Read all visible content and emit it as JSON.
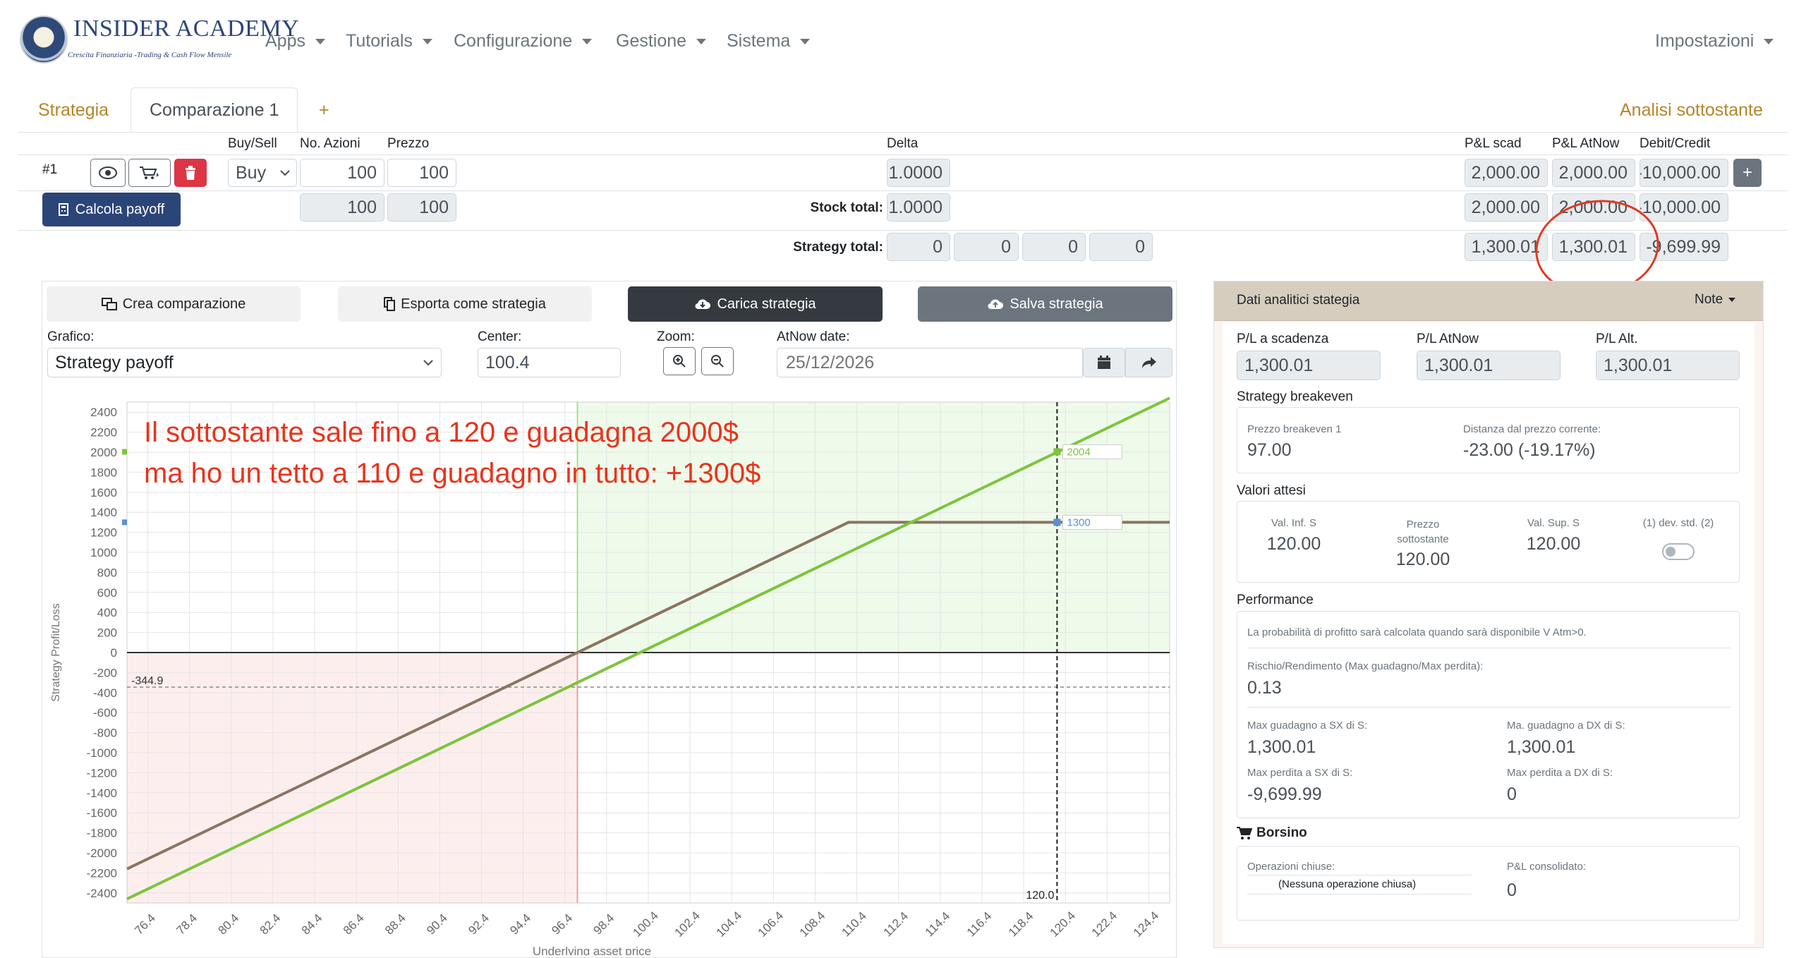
{
  "nav": {
    "logo_title": "INSIDER ACADEMY",
    "logo_subtitle": "Crescita Finanziaria -Trading & Cash Flow Mensile",
    "items": [
      "Apps",
      "Tutorials",
      "Configurazione",
      "Gestione",
      "Sistema"
    ],
    "settings": "Impostazioni"
  },
  "tabs": {
    "strategy": "Strategia",
    "comparison": "Comparazione 1",
    "add": "+",
    "analysis": "Analisi sottostante"
  },
  "table": {
    "headers": {
      "buy_sell": "Buy/Sell",
      "shares": "No. Azioni",
      "price": "Prezzo",
      "delta": "Delta",
      "pl_exp": "P&L scad",
      "pl_atnow": "P&L AtNow",
      "debit_credit": "Debit/Credit"
    },
    "row1": {
      "label": "#1",
      "side": "Buy",
      "shares": "100",
      "price": "100",
      "delta": "1.0000",
      "pl_exp": "2,000.00",
      "pl_atnow": "2,000.00",
      "debit_credit": "-10,000.00"
    },
    "calc_button": "Calcola payoff",
    "stock_total": {
      "label": "Stock total:",
      "shares": "100",
      "price": "100",
      "delta": "1.0000",
      "pl_exp": "2,000.00",
      "pl_atnow": "2,000.00",
      "debit_credit": "-10,000.00"
    },
    "strategy_total": {
      "label": "Strategy total:",
      "g1": "0",
      "g2": "0",
      "g3": "0",
      "g4": "0",
      "pl_exp": "1,300.01",
      "pl_atnow": "1,300.01",
      "debit_credit": "-9,699.99"
    },
    "add_button": "+"
  },
  "toolbar": {
    "create": "Crea comparazione",
    "export": "Esporta come strategia",
    "load": "Carica strategia",
    "save": "Salva strategia"
  },
  "controls": {
    "graph_label": "Grafico:",
    "graph_value": "Strategy payoff",
    "center_label": "Center:",
    "center_value": "100.4",
    "zoom_label": "Zoom:",
    "atnow_label": "AtNow date:",
    "atnow_placeholder": "25/12/2026"
  },
  "annotation": {
    "line1": "Il sottostante sale fino a 120 e guadagna 2000$",
    "line2": "ma ho un tetto a 110 e guadagno in tutto: +1300$"
  },
  "chart_data": {
    "type": "line",
    "ylabel": "Strategy Profit/Loss",
    "xlabel": "Underlying asset price",
    "xlim": [
      75.4,
      125.4
    ],
    "ylim": [
      -2500,
      2500
    ],
    "yticks": [
      2400,
      2200,
      2000,
      1800,
      1600,
      1400,
      1200,
      1000,
      800,
      600,
      400,
      200,
      0,
      -200,
      -400,
      -600,
      -800,
      -1000,
      -1200,
      -1400,
      -1600,
      -1800,
      -2000,
      -2200,
      -2400
    ],
    "xticks": [
      "76.4",
      "78.4",
      "80.4",
      "82.4",
      "84.4",
      "86.4",
      "88.4",
      "90.4",
      "92.4",
      "94.4",
      "96.4",
      "98.4",
      "100.4",
      "102.4",
      "104.4",
      "106.4",
      "108.4",
      "110.4",
      "112.4",
      "114.4",
      "116.4",
      "118.4",
      "120.4",
      "122.4",
      "124.4"
    ],
    "series": [
      {
        "color": "#8a7560",
        "x": [
          75.4,
          110,
          125.4
        ],
        "y": [
          -2160,
          1300,
          1300
        ]
      },
      {
        "color": "#7dc43c",
        "x": [
          75.4,
          125.4
        ],
        "y": [
          -2460,
          2540
        ]
      }
    ],
    "breakeven_x": 97.0,
    "cursor_x": 120.0,
    "cursor_label": "120.0",
    "hline_y": -344.9,
    "hline_label": "-344.9",
    "marker_labels": [
      {
        "x": 120,
        "y": 2004,
        "text": "2004",
        "color": "#7dc43c"
      },
      {
        "x": 120,
        "y": 1300,
        "text": "1300",
        "color": "#5b8fd6"
      }
    ],
    "colors": {
      "loss_area": "#fdeeee",
      "profit_area": "#eefaea"
    }
  },
  "panel": {
    "title": "Dati analitici stategia",
    "note": "Note",
    "pl_exp_label": "P/L a scadenza",
    "pl_exp": "1,300.01",
    "pl_atnow_label": "P/L AtNow",
    "pl_atnow": "1,300.01",
    "pl_alt_label": "P/L Alt.",
    "pl_alt": "1,300.01",
    "breakeven_title": "Strategy breakeven",
    "be1_label": "Prezzo breakeven 1",
    "be1": "97.00",
    "dist_label": "Distanza dal prezzo corrente:",
    "dist": "-23.00 (-19.17%)",
    "expected_title": "Valori attesi",
    "inf_label": "Val. Inf. S",
    "inf": "120.00",
    "under_label": "Prezzo sottostante",
    "under": "120.00",
    "sup_label": "Val. Sup. S",
    "sup": "120.00",
    "devstd_label": "(1) dev. std. (2)",
    "perf_title": "Performance",
    "prob_note": "La probabilità di profitto sarà calcolata quando sarà disponibile V Atm>0.",
    "rr_label": "Rischio/Rendimento (Max guadagno/Max perdita):",
    "rr": "0.13",
    "maxg_sx_label": "Max guadagno a SX di S:",
    "maxg_sx": "1,300.01",
    "maxg_dx_label": "Ma. guadagno a DX di S:",
    "maxg_dx": "1,300.01",
    "maxp_sx_label": "Max perdita a SX di S:",
    "maxp_sx": "-9,699.99",
    "maxp_dx_label": "Max perdita a DX di S:",
    "maxp_dx": "0",
    "borsino_title": "Borsino",
    "closed_label": "Operazioni chiuse:",
    "closed_value": "(Nessuna operazione chiusa)",
    "pl_cons_label": "P&L consolidato:",
    "pl_cons": "0"
  }
}
